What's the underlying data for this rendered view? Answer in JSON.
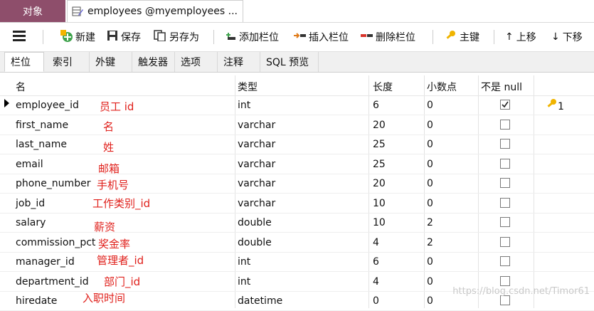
{
  "tabs": {
    "objects": "对象",
    "doc": "employees @myemployees ..."
  },
  "toolbar": {
    "new": "新建",
    "save": "保存",
    "save_as": "另存为",
    "add_field": "添加栏位",
    "insert_field": "插入栏位",
    "delete_field": "删除栏位",
    "primary_key": "主键",
    "move_up": "上移",
    "move_down": "下移"
  },
  "subtabs": [
    "栏位",
    "索引",
    "外键",
    "触发器",
    "选项",
    "注释",
    "SQL 预览"
  ],
  "columns": {
    "name": "名",
    "type": "类型",
    "length": "长度",
    "decimals": "小数点",
    "not_null": "不是 null"
  },
  "rows": [
    {
      "name": "employee_id",
      "type": "int",
      "length": "6",
      "dec": "0",
      "notnull": true,
      "key": "1",
      "anno": "员工 id"
    },
    {
      "name": "first_name",
      "type": "varchar",
      "length": "20",
      "dec": "0",
      "notnull": false,
      "anno": "名"
    },
    {
      "name": "last_name",
      "type": "varchar",
      "length": "25",
      "dec": "0",
      "notnull": false,
      "anno": "姓"
    },
    {
      "name": "email",
      "type": "varchar",
      "length": "25",
      "dec": "0",
      "notnull": false,
      "anno": "邮箱"
    },
    {
      "name": "phone_number",
      "type": "varchar",
      "length": "20",
      "dec": "0",
      "notnull": false,
      "anno": "手机号"
    },
    {
      "name": "job_id",
      "type": "varchar",
      "length": "10",
      "dec": "0",
      "notnull": false,
      "anno": "工作类别_id"
    },
    {
      "name": "salary",
      "type": "double",
      "length": "10",
      "dec": "2",
      "notnull": false,
      "anno": "薪资"
    },
    {
      "name": "commission_pct",
      "type": "double",
      "length": "4",
      "dec": "2",
      "notnull": false,
      "anno": "奖金率"
    },
    {
      "name": "manager_id",
      "type": "int",
      "length": "6",
      "dec": "0",
      "notnull": false,
      "anno": "管理者_id"
    },
    {
      "name": "department_id",
      "type": "int",
      "length": "4",
      "dec": "0",
      "notnull": false,
      "anno": "部门_id"
    },
    {
      "name": "hiredate",
      "type": "datetime",
      "length": "0",
      "dec": "0",
      "notnull": false,
      "anno": "入职时间"
    }
  ],
  "watermark": "https://blog.csdn.net/Timor61",
  "colors": {
    "accent": "#8e4e6b",
    "annotation": "#e0201b"
  }
}
